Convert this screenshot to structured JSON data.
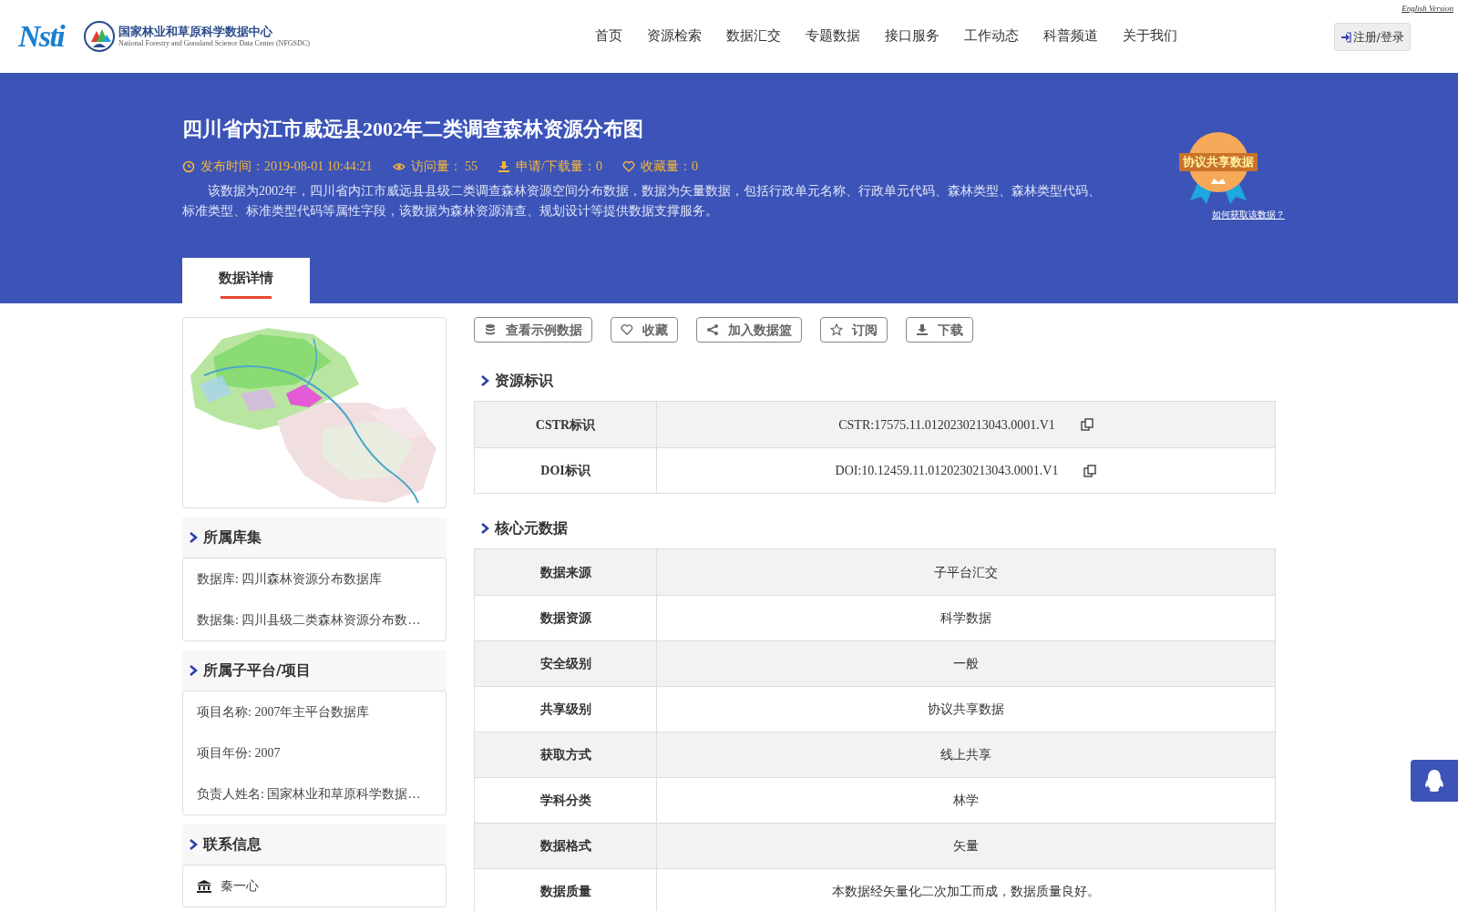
{
  "header": {
    "logo_text": "Nsti",
    "org_name": "国家林业和草原科学数据中心",
    "org_name_en": "National Forestry and Grassland Science Data Center (NFGSDC)",
    "nav": [
      "首页",
      "资源检索",
      "数据汇交",
      "专题数据",
      "接口服务",
      "工作动态",
      "科普频道",
      "关于我们"
    ],
    "english_link": "English Version",
    "login_button": "注册/登录"
  },
  "dataset": {
    "title": "四川省内江市威远县2002年二类调查森林资源分布图",
    "meta": [
      {
        "kind": "time",
        "text": "发布时间：2019-08-01 10:44:21"
      },
      {
        "kind": "views",
        "text": "访问量： 55"
      },
      {
        "kind": "downloads",
        "text": "申请/下载量：0"
      },
      {
        "kind": "favorites",
        "text": "收藏量：0"
      }
    ],
    "description": "该数据为2002年，四川省内江市威远县县级二类调查森林资源空间分布数据，数据为矢量数据，包括行政单元名称、行政单元代码、森林类型、森林类型代码、标准类型、标准类型代码等属性字段，该数据为森林资源清查、规划设计等提供数据支撑服务。",
    "badge": {
      "text": "协议共享数据",
      "link": "如何获取该数据？"
    }
  },
  "tabs": [
    {
      "label": "数据详情",
      "selected": true
    }
  ],
  "left_sections": [
    {
      "title": "所属库集",
      "items": [
        {
          "kind": "text",
          "text": "数据库: 四川森林资源分布数据库"
        },
        {
          "kind": "text",
          "text": "数据集: 四川县级二类森林资源分布数…"
        }
      ]
    },
    {
      "title": "所属子平台/项目",
      "items": [
        {
          "kind": "text",
          "text": "项目名称: 2007年主平台数据库"
        },
        {
          "kind": "text",
          "text": "项目年份: 2007"
        },
        {
          "kind": "text",
          "text": "负责人姓名: 国家林业和草原科学数据…"
        }
      ]
    },
    {
      "title": "联系信息",
      "items": [
        {
          "kind": "institution",
          "text": "秦一心"
        }
      ]
    }
  ],
  "actions": [
    {
      "kind": "database",
      "label": "查看示例数据"
    },
    {
      "kind": "heart",
      "label": "收藏"
    },
    {
      "kind": "share",
      "label": "加入数据篮"
    },
    {
      "kind": "star",
      "label": "订阅"
    },
    {
      "kind": "download",
      "label": "下载"
    }
  ],
  "identifiers": {
    "title": "资源标识",
    "rows": [
      {
        "label": "CSTR标识",
        "value": "CSTR:17575.11.0120230213043.0001.V1"
      },
      {
        "label": "DOI标识",
        "value": "DOI:10.12459.11.0120230213043.0001.V1"
      }
    ]
  },
  "core_metadata": {
    "title": "核心元数据",
    "rows": [
      {
        "label": "数据来源",
        "value": "子平台汇交"
      },
      {
        "label": "数据资源",
        "value": "科学数据"
      },
      {
        "label": "安全级别",
        "value": "一般"
      },
      {
        "label": "共享级别",
        "value": "协议共享数据"
      },
      {
        "label": "获取方式",
        "value": "线上共享"
      },
      {
        "label": "学科分类",
        "value": "林学"
      },
      {
        "label": "数据格式",
        "value": "矢量"
      },
      {
        "label": "数据质量",
        "value": "本数据经矢量化二次加工而成，数据质量良好。"
      }
    ]
  }
}
